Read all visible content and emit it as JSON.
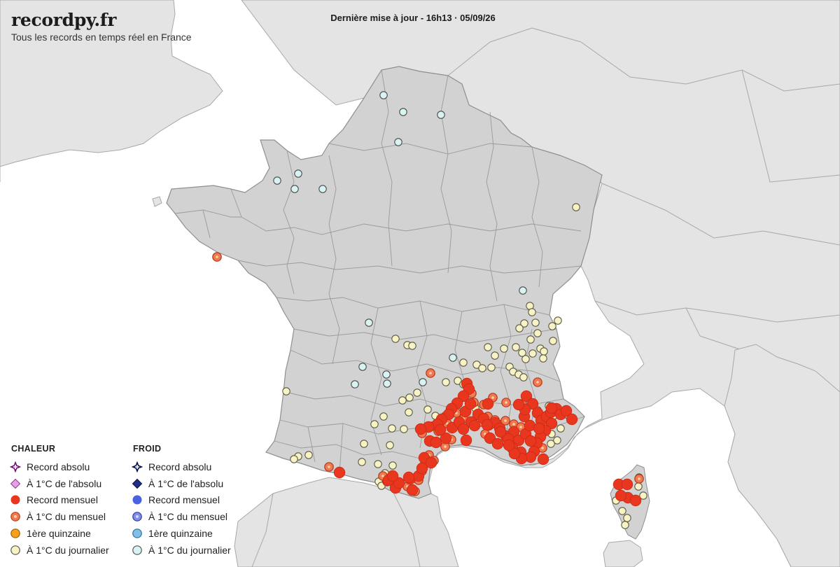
{
  "header": {
    "site_name": "recordpy.fr",
    "tagline": "Tous les records en temps réel en France",
    "updated": "Dernière mise à jour - 16h13 · 05/09/26"
  },
  "colors": {
    "sea": "#ffffff",
    "france": "#d2d2d2",
    "foreign": "#e4e4e4",
    "borders": "#9a9a9a",
    "record_mensuel": "#e8361f",
    "near_mensuel_fill": "#f07a50",
    "near_journalier_fill": "#f8f3c4",
    "cold_near_journalier_fill": "#d7f3f2",
    "quinzaine_heat": "#f4a21c",
    "absolu_heat": "#9b2aa8",
    "near_absolu_heat": "#e7a0e5",
    "absolu_cold": "#14206b",
    "record_mensuel_cold": "#4a62e0",
    "near_mensuel_cold": "#7f8ee8",
    "quinzaine_cold": "#7fbfe8"
  },
  "legend": {
    "heat": {
      "title": "CHALEUR",
      "items": [
        {
          "label": "Record absolu",
          "icon": "absolute-record-heat-icon"
        },
        {
          "label": "À 1°C de l'absolu",
          "icon": "near-absolute-heat-icon"
        },
        {
          "label": "Record mensuel",
          "icon": "monthly-record-heat-icon"
        },
        {
          "label": "À 1°C du mensuel",
          "icon": "near-monthly-heat-icon"
        },
        {
          "label": "1ère quinzaine",
          "icon": "fortnight-heat-icon"
        },
        {
          "label": "À 1°C du journalier",
          "icon": "near-daily-heat-icon"
        }
      ]
    },
    "cold": {
      "title": "FROID",
      "items": [
        {
          "label": "Record absolu",
          "icon": "absolute-record-cold-icon"
        },
        {
          "label": "À 1°C de l'absolu",
          "icon": "near-absolute-cold-icon"
        },
        {
          "label": "Record mensuel",
          "icon": "monthly-record-cold-icon"
        },
        {
          "label": "À 1°C du mensuel",
          "icon": "near-monthly-cold-icon"
        },
        {
          "label": "1ère quinzaine",
          "icon": "fortnight-cold-icon"
        },
        {
          "label": "À 1°C du journalier",
          "icon": "near-daily-cold-icon"
        }
      ]
    }
  },
  "stations": {
    "near_daily_cold": [
      [
        548,
        136
      ],
      [
        576,
        160
      ],
      [
        630,
        164
      ],
      [
        569,
        203
      ],
      [
        396,
        258
      ],
      [
        426,
        248
      ],
      [
        421,
        270
      ],
      [
        461,
        270
      ],
      [
        747,
        415
      ],
      [
        527,
        461
      ],
      [
        518,
        524
      ],
      [
        552,
        535
      ],
      [
        553,
        548
      ],
      [
        507,
        549
      ],
      [
        647,
        511
      ],
      [
        604,
        546
      ]
    ],
    "near_daily_heat": [
      [
        823,
        296
      ],
      [
        757,
        437
      ],
      [
        760,
        446
      ],
      [
        749,
        462
      ],
      [
        765,
        461
      ],
      [
        797,
        458
      ],
      [
        789,
        466
      ],
      [
        742,
        469
      ],
      [
        768,
        476
      ],
      [
        758,
        485
      ],
      [
        565,
        484
      ],
      [
        582,
        493
      ],
      [
        589,
        494
      ],
      [
        697,
        496
      ],
      [
        707,
        508
      ],
      [
        720,
        498
      ],
      [
        737,
        496
      ],
      [
        746,
        504
      ],
      [
        751,
        513
      ],
      [
        772,
        498
      ],
      [
        777,
        502
      ],
      [
        761,
        505
      ],
      [
        790,
        487
      ],
      [
        662,
        518
      ],
      [
        681,
        521
      ],
      [
        689,
        526
      ],
      [
        702,
        525
      ],
      [
        728,
        524
      ],
      [
        733,
        531
      ],
      [
        741,
        535
      ],
      [
        748,
        539
      ],
      [
        776,
        512
      ],
      [
        637,
        546
      ],
      [
        654,
        544
      ],
      [
        662,
        549
      ],
      [
        409,
        559
      ],
      [
        585,
        568
      ],
      [
        575,
        572
      ],
      [
        596,
        561
      ],
      [
        611,
        585
      ],
      [
        679,
        583
      ],
      [
        654,
        588
      ],
      [
        622,
        594
      ],
      [
        584,
        589
      ],
      [
        577,
        613
      ],
      [
        535,
        606
      ],
      [
        548,
        595
      ],
      [
        560,
        612
      ],
      [
        520,
        634
      ],
      [
        557,
        636
      ],
      [
        561,
        665
      ],
      [
        540,
        663
      ],
      [
        517,
        660
      ],
      [
        441,
        650
      ],
      [
        426,
        652
      ],
      [
        420,
        656
      ],
      [
        550,
        676
      ],
      [
        541,
        688
      ],
      [
        545,
        694
      ],
      [
        768,
        586
      ],
      [
        784,
        580
      ],
      [
        801,
        588
      ],
      [
        791,
        594
      ],
      [
        809,
        592
      ],
      [
        788,
        620
      ],
      [
        796,
        629
      ],
      [
        787,
        634
      ],
      [
        801,
        612
      ],
      [
        913,
        682
      ],
      [
        912,
        695
      ],
      [
        919,
        708
      ],
      [
        880,
        715
      ],
      [
        889,
        730
      ],
      [
        896,
        740
      ],
      [
        893,
        750
      ]
    ],
    "near_monthly_heat": [
      [
        310,
        367
      ],
      [
        615,
        533
      ],
      [
        768,
        546
      ],
      [
        674,
        562
      ],
      [
        677,
        575
      ],
      [
        691,
        578
      ],
      [
        704,
        568
      ],
      [
        723,
        575
      ],
      [
        746,
        577
      ],
      [
        636,
        595
      ],
      [
        652,
        590
      ],
      [
        662,
        598
      ],
      [
        617,
        609
      ],
      [
        626,
        616
      ],
      [
        639,
        605
      ],
      [
        645,
        628
      ],
      [
        603,
        619
      ],
      [
        636,
        638
      ],
      [
        686,
        603
      ],
      [
        697,
        595
      ],
      [
        707,
        600
      ],
      [
        712,
        606
      ],
      [
        693,
        620
      ],
      [
        722,
        601
      ],
      [
        734,
        606
      ],
      [
        744,
        610
      ],
      [
        760,
        630
      ],
      [
        775,
        640
      ],
      [
        470,
        667
      ],
      [
        547,
        680
      ],
      [
        553,
        688
      ],
      [
        582,
        695
      ],
      [
        593,
        702
      ],
      [
        598,
        686
      ],
      [
        603,
        673
      ],
      [
        607,
        662
      ],
      [
        613,
        650
      ],
      [
        620,
        658
      ],
      [
        913,
        684
      ],
      [
        885,
        692
      ]
    ],
    "monthly_record_heat": [
      [
        667,
        548
      ],
      [
        670,
        556
      ],
      [
        662,
        566
      ],
      [
        653,
        576
      ],
      [
        645,
        584
      ],
      [
        641,
        592
      ],
      [
        631,
        599
      ],
      [
        625,
        606
      ],
      [
        612,
        610
      ],
      [
        601,
        613
      ],
      [
        614,
        630
      ],
      [
        623,
        632
      ],
      [
        637,
        626
      ],
      [
        629,
        614
      ],
      [
        646,
        611
      ],
      [
        656,
        603
      ],
      [
        665,
        588
      ],
      [
        672,
        577
      ],
      [
        683,
        592
      ],
      [
        673,
        603
      ],
      [
        662,
        613
      ],
      [
        678,
        608
      ],
      [
        691,
        598
      ],
      [
        698,
        607
      ],
      [
        707,
        604
      ],
      [
        714,
        612
      ],
      [
        700,
        626
      ],
      [
        711,
        634
      ],
      [
        723,
        623
      ],
      [
        734,
        617
      ],
      [
        741,
        629
      ],
      [
        751,
        620
      ],
      [
        757,
        608
      ],
      [
        749,
        595
      ],
      [
        752,
        566
      ],
      [
        761,
        577
      ],
      [
        768,
        590
      ],
      [
        773,
        601
      ],
      [
        781,
        595
      ],
      [
        787,
        589
      ],
      [
        795,
        584
      ],
      [
        801,
        592
      ],
      [
        809,
        587
      ],
      [
        817,
        599
      ],
      [
        788,
        605
      ],
      [
        779,
        615
      ],
      [
        772,
        624
      ],
      [
        767,
        633
      ],
      [
        763,
        645
      ],
      [
        758,
        653
      ],
      [
        744,
        646
      ],
      [
        732,
        640
      ],
      [
        726,
        627
      ],
      [
        715,
        617
      ],
      [
        750,
        585
      ],
      [
        741,
        578
      ],
      [
        758,
        630
      ],
      [
        770,
        612
      ],
      [
        745,
        655
      ],
      [
        735,
        648
      ],
      [
        727,
        636
      ],
      [
        776,
        656
      ],
      [
        788,
        583
      ],
      [
        697,
        577
      ],
      [
        696,
        607
      ],
      [
        666,
        629
      ],
      [
        485,
        675
      ],
      [
        565,
        697
      ],
      [
        555,
        686
      ],
      [
        570,
        690
      ],
      [
        586,
        684
      ],
      [
        598,
        680
      ],
      [
        603,
        669
      ],
      [
        606,
        654
      ],
      [
        561,
        680
      ],
      [
        584,
        682
      ],
      [
        616,
        661
      ],
      [
        589,
        700
      ],
      [
        884,
        692
      ],
      [
        896,
        692
      ],
      [
        897,
        711
      ],
      [
        908,
        715
      ],
      [
        887,
        708
      ]
    ]
  }
}
